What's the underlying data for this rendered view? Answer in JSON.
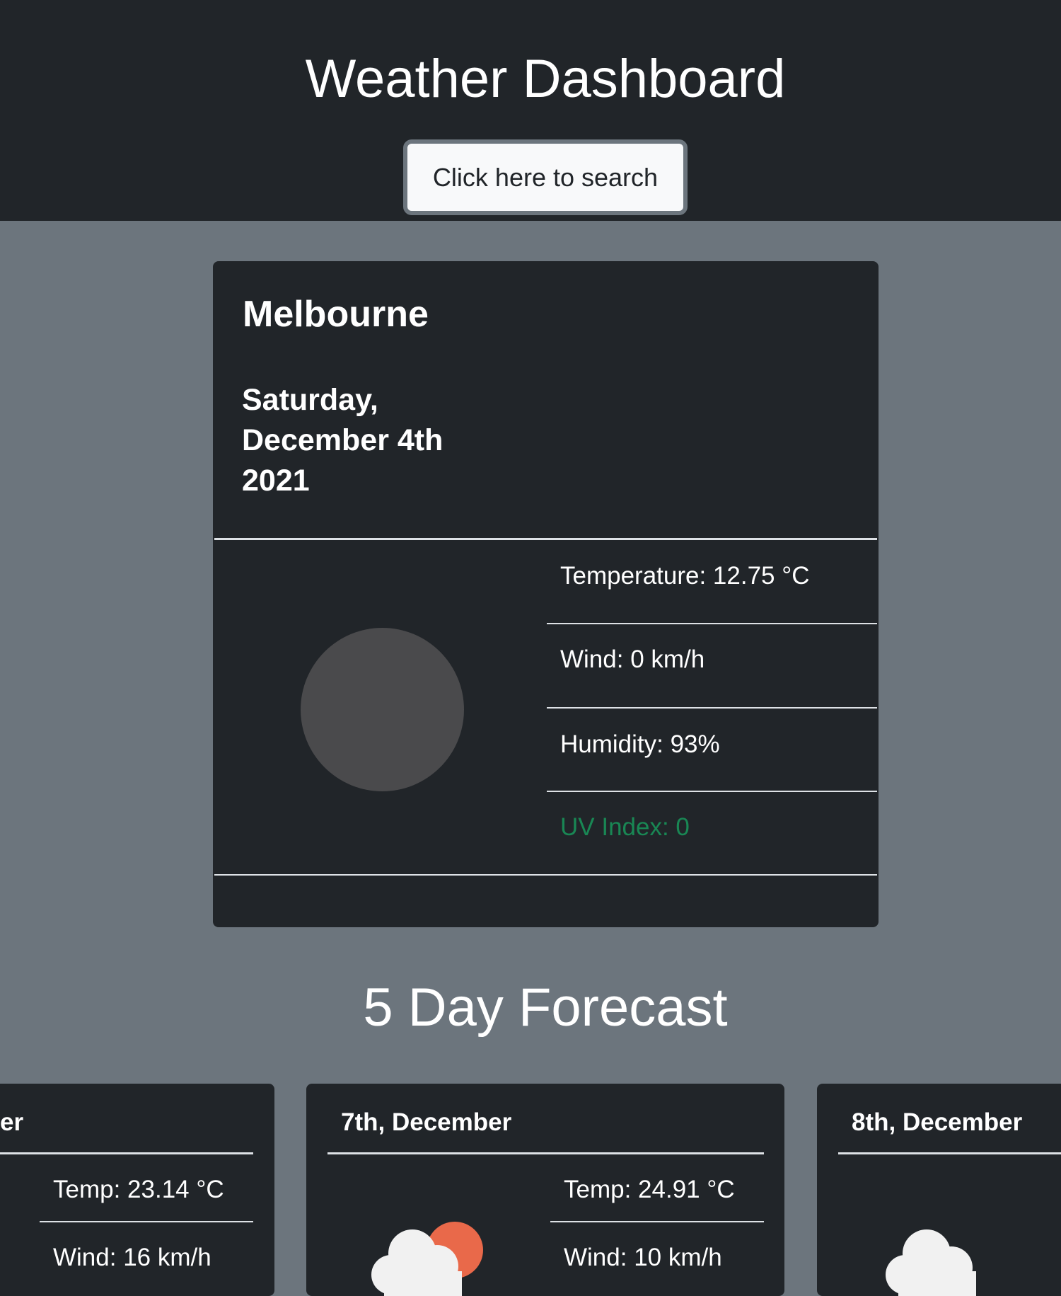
{
  "header": {
    "title": "Weather Dashboard",
    "search_button": "Click here to search"
  },
  "current": {
    "city": "Melbourne",
    "date_line1": "Saturday,",
    "date_line2": "December 4th",
    "date_line3": "2021",
    "icon": "night-clear-icon",
    "temperature": "Temperature: 12.75 °C",
    "wind": "Wind: 0 km/h",
    "humidity": "Humidity: 93%",
    "uv": "UV Index: 0",
    "uv_color": "#198754"
  },
  "forecast": {
    "title": "5 Day Forecast",
    "days": [
      {
        "date": "er",
        "temp": "Temp: 23.14 °C",
        "wind": "Wind: 16 km/h"
      },
      {
        "date": "7th, December",
        "temp": "Temp: 24.91 °C",
        "wind": "Wind: 10 km/h",
        "icon": "partly-cloudy-icon"
      },
      {
        "date": "8th, December",
        "icon": "cloud-icon"
      }
    ]
  },
  "colors": {
    "header_bg": "#212529",
    "page_bg": "#6c757d",
    "card_bg": "#212529",
    "sun": "#e9694a",
    "cloud": "#f1f1f1"
  }
}
